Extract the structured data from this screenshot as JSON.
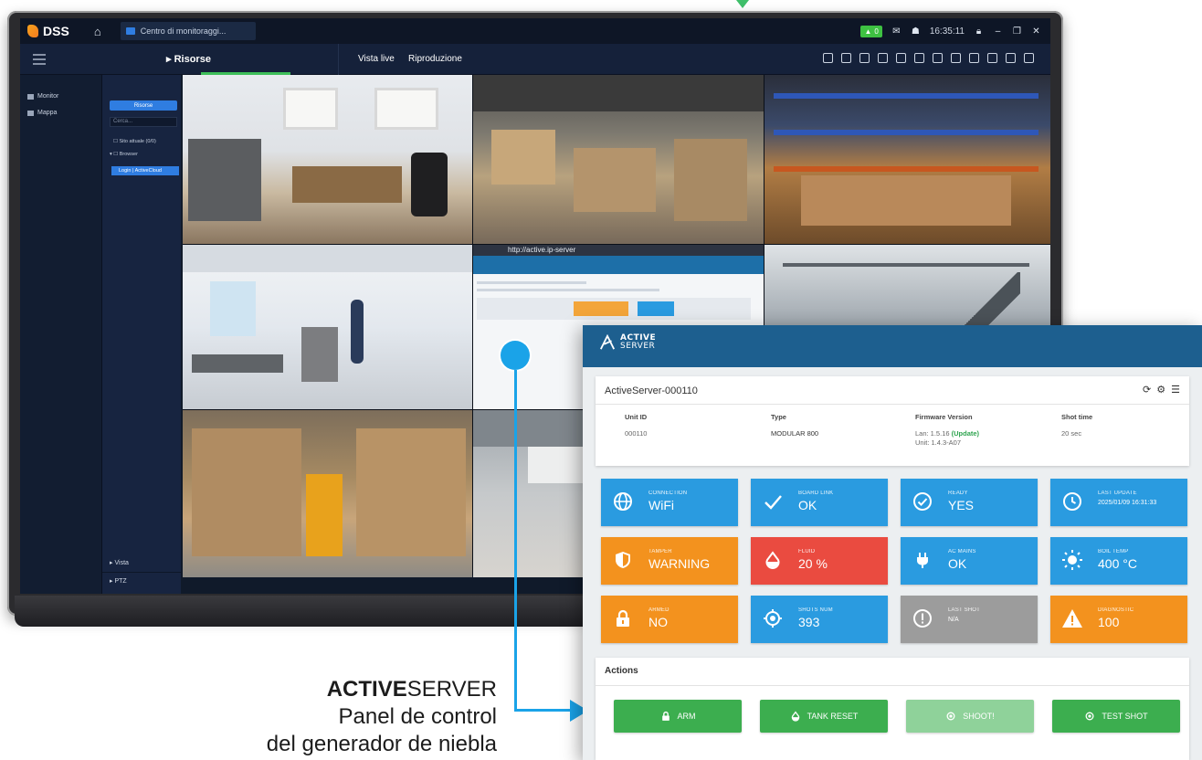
{
  "dss": {
    "app_name": "DSS",
    "tab_title": "Centro di monitoraggi...",
    "alarm_count": "0",
    "clock": "16:35:11",
    "toolbar": {
      "resources_label": "Risorse",
      "live_view_label": "Vista live",
      "playback_label": "Riproduzione"
    },
    "rail": [
      {
        "label": "Monitor",
        "icon": "monitor-icon"
      },
      {
        "label": "Mappa",
        "icon": "map-icon"
      }
    ],
    "tree": {
      "tab_label": "Risorse",
      "search_placeholder": "Cerca...",
      "nodes": [
        "Sito attuale (0/0)",
        "Browser"
      ],
      "selected_node": "Login | ActiveCloud",
      "sections": [
        "Vista",
        "PTZ"
      ]
    },
    "browser_url": "http://active.ip-server"
  },
  "active_server": {
    "logo_top": "ACTIVE",
    "logo_bottom": "SERVER",
    "device_name": "ActiveServer-000110",
    "info": {
      "unit_id_label": "Unit ID",
      "unit_id": "000110",
      "type_label": "Type",
      "type": "MODULAR 800",
      "firmware_label": "Firmware Version",
      "firmware_lan": "Lan: 1.5.16",
      "firmware_update": "(Update)",
      "firmware_unit": "Unit: 1.4.3-A07",
      "shot_time_label": "Shot time",
      "shot_time": "20 sec"
    },
    "tiles": [
      {
        "label": "CONNECTION",
        "value": "WiFi",
        "color": "#2a9be0",
        "icon": "globe-icon"
      },
      {
        "label": "BOARD LINK",
        "value": "OK",
        "color": "#2a9be0",
        "icon": "check-icon"
      },
      {
        "label": "READY",
        "value": "YES",
        "color": "#2a9be0",
        "icon": "check-circle-icon"
      },
      {
        "label": "LAST UPDATE",
        "value": "2025/01/09 16:31:33",
        "color": "#2a9be0",
        "icon": "clock-icon"
      },
      {
        "label": "TAMPER",
        "value": "WARNING",
        "color": "#f3921e",
        "icon": "shield-icon"
      },
      {
        "label": "FLUID",
        "value": "20 %",
        "color": "#ea4b40",
        "icon": "drop-icon"
      },
      {
        "label": "AC MAINS",
        "value": "OK",
        "color": "#2a9be0",
        "icon": "plug-icon"
      },
      {
        "label": "BOIL TEMP",
        "value": "400 °C",
        "color": "#2a9be0",
        "icon": "sun-icon"
      },
      {
        "label": "ARMED",
        "value": "NO",
        "color": "#f3921e",
        "icon": "lock-icon"
      },
      {
        "label": "SHOTS NUM",
        "value": "393",
        "color": "#2a9be0",
        "icon": "target-icon"
      },
      {
        "label": "LAST SHOT",
        "value": "N/A",
        "color": "#9c9c9c",
        "icon": "alert-circle-icon"
      },
      {
        "label": "DIAGNOSTIC",
        "value": "100",
        "color": "#f3921e",
        "icon": "warning-icon"
      }
    ],
    "actions_title": "Actions",
    "actions": [
      {
        "label": "ARM",
        "icon": "lock-icon",
        "enabled": true
      },
      {
        "label": "TANK RESET",
        "icon": "drop-icon",
        "enabled": true
      },
      {
        "label": "SHOOT!",
        "icon": "target-icon",
        "enabled": false
      },
      {
        "label": "TEST SHOT",
        "icon": "target-icon",
        "enabled": true
      }
    ]
  },
  "caption": {
    "brand_bold": "ACTIVE",
    "brand_light": "SERVER",
    "line2": "Panel de control",
    "line3": "del generador de niebla"
  }
}
